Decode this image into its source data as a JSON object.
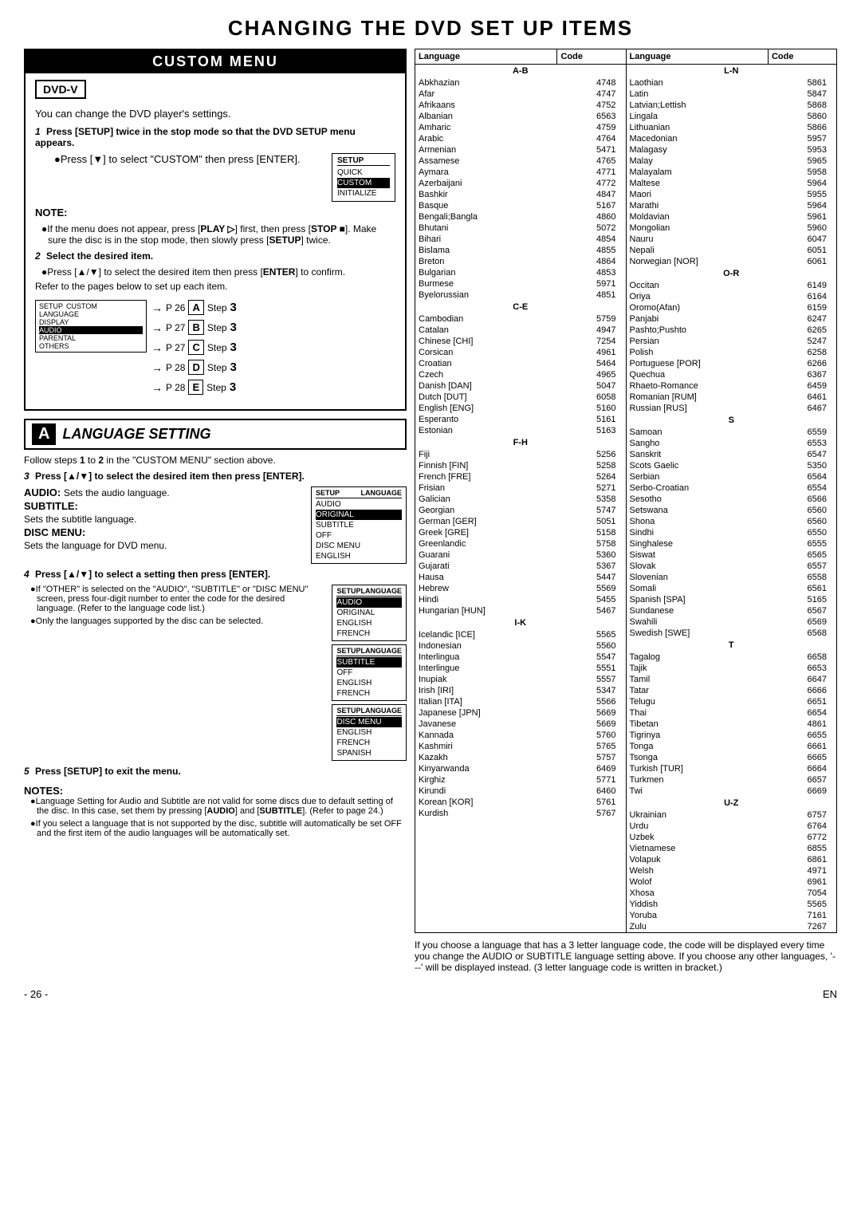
{
  "page": {
    "main_title": "CHANGING THE DVD SET UP ITEMS",
    "page_number": "- 26 -",
    "page_en": "EN"
  },
  "custom_menu": {
    "title": "CUSTOM MENU",
    "dvd_badge": "DVD-V",
    "intro_text": "You can change the DVD player's settings.",
    "step1_bold": "Press [SETUP] twice in the stop mode so that the DVD SETUP menu appears.",
    "step1_bullet": "Press [▼] to select \"CUSTOM\" then press [ENTER].",
    "setup_menu": {
      "title": "SETUP",
      "items": [
        "QUICK",
        "CUSTOM",
        "INITIALIZE"
      ],
      "selected": "CUSTOM"
    },
    "note_label": "NOTE:",
    "note_bullets": [
      "If the menu does not appear, press [PLAY ▷] first, then press [STOP ■]. Make sure the disc is in the stop mode, then slowly press [SETUP] twice.",
      "Select the desired item.",
      "Press [▲/▼] to select the desired item then press [ENTER] to confirm.",
      "Refer to the pages below to set up each item."
    ],
    "steps": [
      {
        "page": "P 26",
        "letter": "A",
        "step": "Step 3"
      },
      {
        "page": "P 27",
        "letter": "B",
        "step": "Step 3"
      },
      {
        "page": "P 27",
        "letter": "C",
        "step": "Step 3"
      },
      {
        "page": "P 28",
        "letter": "D",
        "step": "Step 3"
      },
      {
        "page": "P 28",
        "letter": "E",
        "step": "Step 3"
      }
    ],
    "setup_box_items": [
      "LANGUAGE",
      "DISPLAY",
      "AUDIO",
      "PARENTAL",
      "OTHERS"
    ]
  },
  "language_setting": {
    "letter_badge": "A",
    "title": "LANGUAGE SETTING",
    "follow_text": "Follow steps 1 to 2 in the \"CUSTOM MENU\" section above.",
    "step3_bold": "Press [▲/▼] to select the desired item then press [ENTER].",
    "audio_label": "AUDIO:",
    "audio_text": "Sets the audio language.",
    "subtitle_label": "SUBTITLE:",
    "subtitle_text": "Sets the subtitle language.",
    "disc_menu_label": "DISC MENU:",
    "disc_menu_text": "Sets the language for DVD menu.",
    "setup_box1": {
      "title1": "SETUP",
      "title2": "LANGUAGE",
      "rows": [
        "AUDIO",
        "ORIGINAL",
        "SUBTITLE",
        "OFF",
        "DISC MENU",
        "ENGLISH"
      ]
    },
    "step4_bold": "Press [▲/▼] to select a setting then press [ENTER].",
    "if_other_bullets": [
      "If \"OTHER\" is selected on the \"AUDIO\", \"SUBTITLE\" or \"DISC MENU\" screen, press four-digit number to enter the code for the desired language. (Refer to the language code list.)",
      "Only the languages supported by the disc can be selected."
    ],
    "setup_box_audio": {
      "title1": "SETUP",
      "title2": "LANGUAGE",
      "rows": [
        "AUDIO",
        "ORIGINAL",
        "ENGLISH",
        "FRENCH"
      ]
    },
    "setup_box_subtitle": {
      "title1": "SETUP",
      "title2": "LANGUAGE",
      "rows": [
        "SUBTITLE",
        "OFF",
        "ENGLISH",
        "FRENCH"
      ]
    },
    "setup_box_discmenu": {
      "title1": "SETUP",
      "title2": "LANGUAGE",
      "rows": [
        "DISC MENU",
        "ENGLISH",
        "FRENCH",
        "SPANISH"
      ]
    },
    "step5_bold": "Press [SETUP] to exit the menu.",
    "notes_label": "NOTES:",
    "notes_bullets": [
      "Language Setting for Audio and Subtitle are not valid for some discs due to default setting of the disc. In this case, set them by pressing [AUDIO] and [SUBTITLE]. (Refer to page 24.)",
      "If you select a language that is not supported by the disc, subtitle will automatically be set OFF and the first item of the audio languages will be automatically set."
    ]
  },
  "language_table": {
    "col_headers": [
      "Language",
      "Code",
      "Language",
      "Code"
    ],
    "section_ab": "A-B",
    "section_ln": "L-N",
    "section_ce": "C-E",
    "section_fh": "F-H",
    "section_ik": "I-K",
    "section_or": "O-R",
    "section_s": "S",
    "section_t": "T",
    "section_uz": "U-Z",
    "left_languages": [
      {
        "name": "Abkhazian",
        "code": "4748"
      },
      {
        "name": "Afar",
        "code": "4747"
      },
      {
        "name": "Afrikaans",
        "code": "4752"
      },
      {
        "name": "Albanian",
        "code": "6563"
      },
      {
        "name": "Amharic",
        "code": "4759"
      },
      {
        "name": "Arabic",
        "code": "4764"
      },
      {
        "name": "Armenian",
        "code": "5471"
      },
      {
        "name": "Assamese",
        "code": "4765"
      },
      {
        "name": "Aymara",
        "code": "4771"
      },
      {
        "name": "Azerbaijani",
        "code": "4772"
      },
      {
        "name": "Bashkir",
        "code": "4847"
      },
      {
        "name": "Basque",
        "code": "5167"
      },
      {
        "name": "Bengali;Bangla",
        "code": "4860"
      },
      {
        "name": "Bhutani",
        "code": "5072"
      },
      {
        "name": "Bihari",
        "code": "4854"
      },
      {
        "name": "Bislama",
        "code": "4855"
      },
      {
        "name": "Breton",
        "code": "4864"
      },
      {
        "name": "Bulgarian",
        "code": "4853"
      },
      {
        "name": "Burmese",
        "code": "5971"
      },
      {
        "name": "Byelorussian",
        "code": "4851"
      },
      {
        "name": "Cambodian",
        "code": "5759"
      },
      {
        "name": "Catalan",
        "code": "4947"
      },
      {
        "name": "Chinese [CHI]",
        "code": "7254"
      },
      {
        "name": "Corsican",
        "code": "4961"
      },
      {
        "name": "Croatian",
        "code": "5464"
      },
      {
        "name": "Czech",
        "code": "4965"
      },
      {
        "name": "Danish [DAN]",
        "code": "5047"
      },
      {
        "name": "Dutch [DUT]",
        "code": "6058"
      },
      {
        "name": "English [ENG]",
        "code": "5160"
      },
      {
        "name": "Esperanto",
        "code": "5161"
      },
      {
        "name": "Estonian",
        "code": "5163"
      },
      {
        "name": "Fiji",
        "code": "5256"
      },
      {
        "name": "Finnish [FIN]",
        "code": "5258"
      },
      {
        "name": "French [FRE]",
        "code": "5264"
      },
      {
        "name": "Frisian",
        "code": "5271"
      },
      {
        "name": "Galician",
        "code": "5358"
      },
      {
        "name": "Georgian",
        "code": "5747"
      },
      {
        "name": "German [GER]",
        "code": "5051"
      },
      {
        "name": "Greek [GRE]",
        "code": "5158"
      },
      {
        "name": "Greenlandic",
        "code": "5758"
      },
      {
        "name": "Guarani",
        "code": "5360"
      },
      {
        "name": "Gujarati",
        "code": "5367"
      },
      {
        "name": "Hausa",
        "code": "5447"
      },
      {
        "name": "Hebrew",
        "code": "5569"
      },
      {
        "name": "Hindi",
        "code": "5455"
      },
      {
        "name": "Hungarian [HUN]",
        "code": "5467"
      },
      {
        "name": "Icelandic [ICE]",
        "code": "5565"
      },
      {
        "name": "Indonesian",
        "code": "5560"
      },
      {
        "name": "Interlingua",
        "code": "5547"
      },
      {
        "name": "Interlingue",
        "code": "5551"
      },
      {
        "name": "Inupiak",
        "code": "5557"
      },
      {
        "name": "Irish [IRI]",
        "code": "5347"
      },
      {
        "name": "Italian [ITA]",
        "code": "5566"
      },
      {
        "name": "Japanese [JPN]",
        "code": "5669"
      },
      {
        "name": "Javanese",
        "code": "5669"
      },
      {
        "name": "Kannada",
        "code": "5760"
      },
      {
        "name": "Kashmiri",
        "code": "5765"
      },
      {
        "name": "Kazakh",
        "code": "5757"
      },
      {
        "name": "Kinyarwanda",
        "code": "6469"
      },
      {
        "name": "Kirghiz",
        "code": "5771"
      },
      {
        "name": "Kirundi",
        "code": "6460"
      },
      {
        "name": "Korean [KOR]",
        "code": "5761"
      },
      {
        "name": "Kurdish",
        "code": "5767"
      }
    ],
    "right_languages": [
      {
        "name": "Laothian",
        "code": "5861"
      },
      {
        "name": "Latin",
        "code": "5847"
      },
      {
        "name": "Latvian;Lettish",
        "code": "5868"
      },
      {
        "name": "Lingala",
        "code": "5860"
      },
      {
        "name": "Lithuanian",
        "code": "5866"
      },
      {
        "name": "Macedonian",
        "code": "5957"
      },
      {
        "name": "Malagasy",
        "code": "5953"
      },
      {
        "name": "Malay",
        "code": "5965"
      },
      {
        "name": "Malayalam",
        "code": "5958"
      },
      {
        "name": "Maltese",
        "code": "5964"
      },
      {
        "name": "Maori",
        "code": "5955"
      },
      {
        "name": "Marathi",
        "code": "5964"
      },
      {
        "name": "Moldavian",
        "code": "5961"
      },
      {
        "name": "Mongolian",
        "code": "5960"
      },
      {
        "name": "Nauru",
        "code": "6047"
      },
      {
        "name": "Nepali",
        "code": "6051"
      },
      {
        "name": "Norwegian [NOR]",
        "code": "6061"
      },
      {
        "name": "Occitan",
        "code": "6149"
      },
      {
        "name": "Oriya",
        "code": "6164"
      },
      {
        "name": "Oromo(Afan)",
        "code": "6159"
      },
      {
        "name": "Panjabi",
        "code": "6247"
      },
      {
        "name": "Pashto;Pushto",
        "code": "6265"
      },
      {
        "name": "Persian",
        "code": "5247"
      },
      {
        "name": "Polish",
        "code": "6258"
      },
      {
        "name": "Portuguese [POR]",
        "code": "6266"
      },
      {
        "name": "Quechua",
        "code": "6367"
      },
      {
        "name": "Rhaeto-Romance",
        "code": "6459"
      },
      {
        "name": "Romanian [RUM]",
        "code": "6461"
      },
      {
        "name": "Russian [RUS]",
        "code": "6467"
      },
      {
        "name": "Samoan",
        "code": "6559"
      },
      {
        "name": "Sangho",
        "code": "6553"
      },
      {
        "name": "Sanskrit",
        "code": "6547"
      },
      {
        "name": "Scots Gaelic",
        "code": "5350"
      },
      {
        "name": "Serbian",
        "code": "6564"
      },
      {
        "name": "Serbo-Croatian",
        "code": "6554"
      },
      {
        "name": "Sesotho",
        "code": "6566"
      },
      {
        "name": "Setswana",
        "code": "6560"
      },
      {
        "name": "Shona",
        "code": "6560"
      },
      {
        "name": "Sindhi",
        "code": "6550"
      },
      {
        "name": "Singhalese",
        "code": "6555"
      },
      {
        "name": "Siswat",
        "code": "6565"
      },
      {
        "name": "Slovak",
        "code": "6557"
      },
      {
        "name": "Slovenian",
        "code": "6558"
      },
      {
        "name": "Somali",
        "code": "6561"
      },
      {
        "name": "Spanish [SPA]",
        "code": "5165"
      },
      {
        "name": "Sundanese",
        "code": "6567"
      },
      {
        "name": "Swahili",
        "code": "6569"
      },
      {
        "name": "Swedish [SWE]",
        "code": "6568"
      },
      {
        "name": "Tagalog",
        "code": "6658"
      },
      {
        "name": "Tajik",
        "code": "6653"
      },
      {
        "name": "Tamil",
        "code": "6647"
      },
      {
        "name": "Tatar",
        "code": "6666"
      },
      {
        "name": "Telugu",
        "code": "6651"
      },
      {
        "name": "Thai",
        "code": "6654"
      },
      {
        "name": "Tibetan",
        "code": "4861"
      },
      {
        "name": "Tigrinya",
        "code": "6655"
      },
      {
        "name": "Tonga",
        "code": "6661"
      },
      {
        "name": "Tsonga",
        "code": "6665"
      },
      {
        "name": "Turkish [TUR]",
        "code": "6664"
      },
      {
        "name": "Turkmen",
        "code": "6657"
      },
      {
        "name": "Twi",
        "code": "6669"
      },
      {
        "name": "Ukrainian",
        "code": "6757"
      },
      {
        "name": "Urdu",
        "code": "6764"
      },
      {
        "name": "Uzbek",
        "code": "6772"
      },
      {
        "name": "Vietnamese",
        "code": "6855"
      },
      {
        "name": "Volapuk",
        "code": "6861"
      },
      {
        "name": "Welsh",
        "code": "4971"
      },
      {
        "name": "Wolof",
        "code": "6961"
      },
      {
        "name": "Xhosa",
        "code": "7054"
      },
      {
        "name": "Yiddish",
        "code": "5565"
      },
      {
        "name": "Yoruba",
        "code": "7161"
      },
      {
        "name": "Zulu",
        "code": "7267"
      }
    ]
  },
  "footer_note": "If you choose a language that has a 3 letter language code, the code will be displayed every time you change the AUDIO or SUBTITLE language setting above. If you choose any other languages, '---' will be displayed instead. (3 letter language code is written in bracket.)"
}
